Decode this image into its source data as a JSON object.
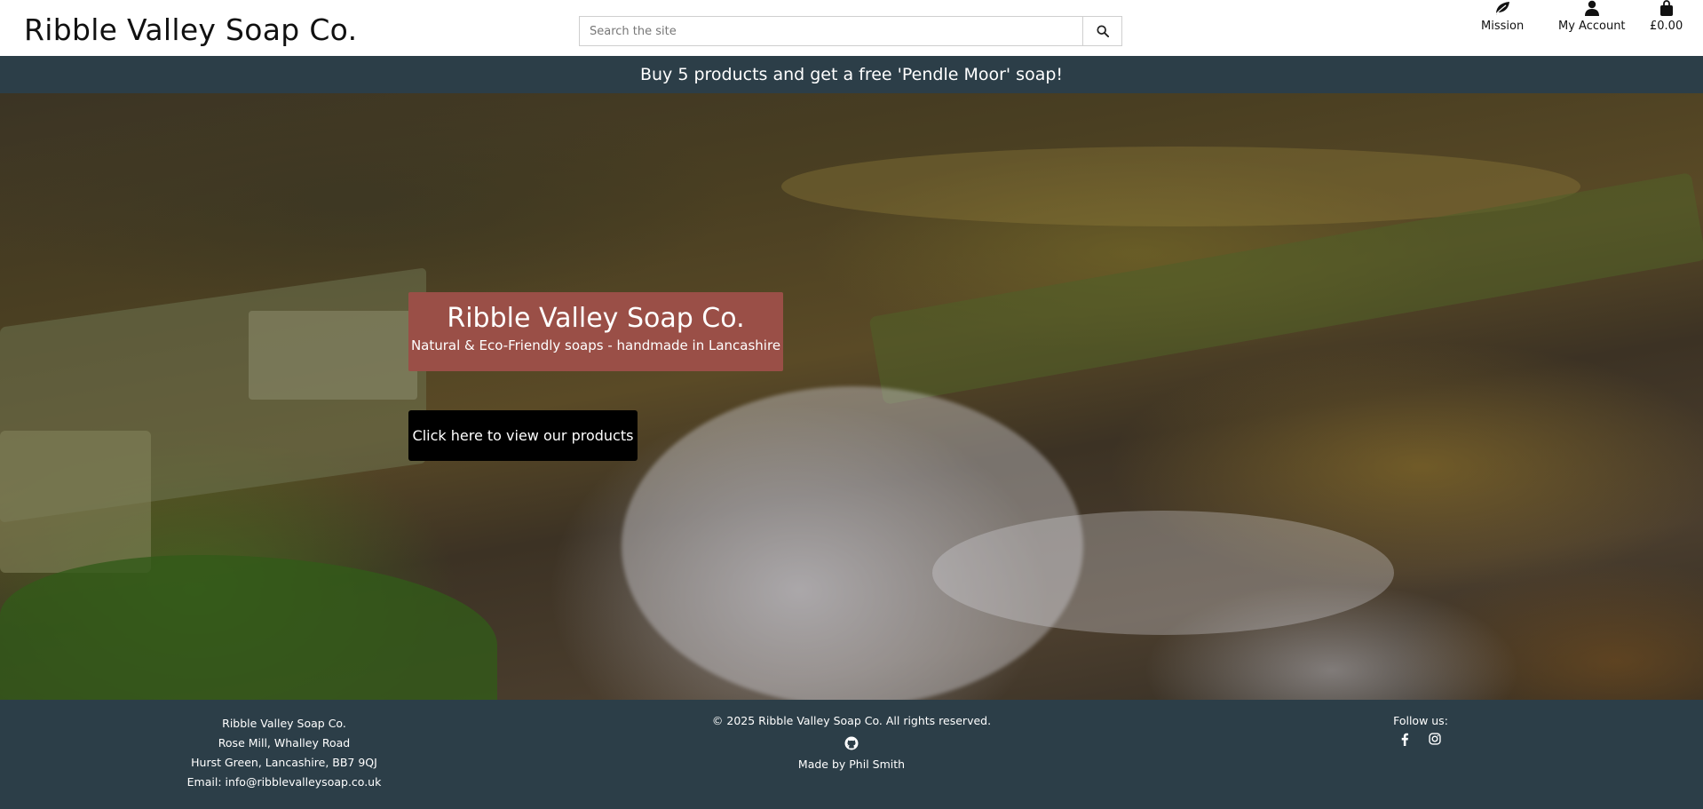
{
  "header": {
    "brand": "Ribble Valley Soap Co.",
    "search_placeholder": "Search the site",
    "nav": {
      "mission_label": "Mission",
      "account_label": "My Account",
      "bag_total": "£0.00"
    }
  },
  "banner": {
    "text": "Buy 5 products and get a free 'Pendle Moor' soap!"
  },
  "hero": {
    "title": "Ribble Valley Soap Co.",
    "subtitle": "Natural & Eco-Friendly soaps - handmade in Lancashire",
    "cta_label": "Click here to view our products"
  },
  "footer": {
    "address": {
      "line1": "Ribble Valley Soap Co.",
      "line2": "Rose Mill, Whalley Road",
      "line3": "Hurst Green, Lancashire, BB7 9QJ",
      "email": "Email: info@ribblevalleysoap.co.uk"
    },
    "copyright": "© 2025 Ribble Valley Soap Co. All rights reserved.",
    "made_by": "Made by Phil Smith",
    "follow_label": "Follow us:"
  },
  "icons": {
    "search": "search-icon",
    "mission": "leaf-icon",
    "account": "user-icon",
    "bag": "shopping-bag-icon",
    "github": "github-icon",
    "facebook": "facebook-icon",
    "instagram": "instagram-icon"
  },
  "colors": {
    "banner_bg": "#2c3e48",
    "footer_bg": "#2c3e48",
    "hero_card_bg": "#9a4f47",
    "cta_bg": "#000000"
  }
}
